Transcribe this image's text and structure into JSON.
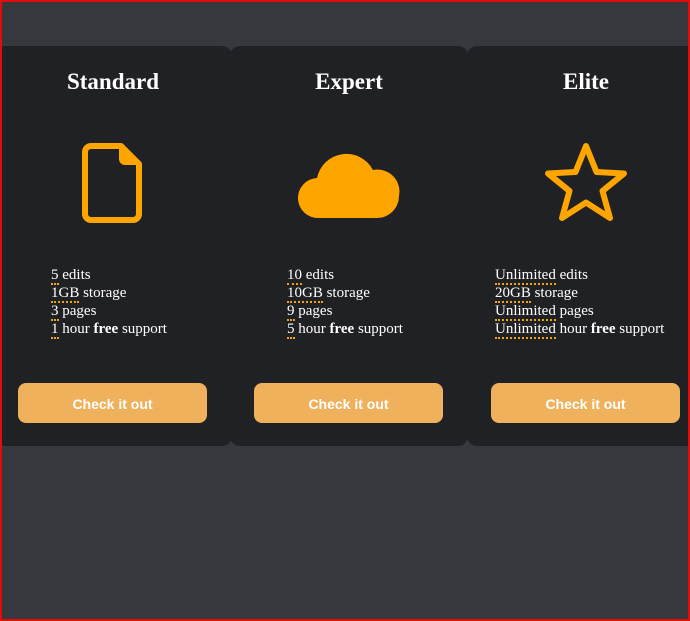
{
  "accent_color": "#ffa500",
  "button_color": "#efb15c",
  "card_background": "#202124",
  "page_background": "#37383d",
  "plans": [
    {
      "name": "Standard",
      "icon": "file-icon",
      "features": [
        {
          "amount": "5",
          "rest": " edits"
        },
        {
          "amount": "1GB",
          "rest": " storage"
        },
        {
          "amount": "3",
          "rest": " pages"
        },
        {
          "amount": "1",
          "rest_before": " hour ",
          "free": "free",
          "rest_after": " support"
        }
      ],
      "button_label": "Check it out"
    },
    {
      "name": "Expert",
      "icon": "cloud-icon",
      "features": [
        {
          "amount": "10",
          "rest": " edits"
        },
        {
          "amount": "10GB",
          "rest": " storage"
        },
        {
          "amount": "9",
          "rest": " pages"
        },
        {
          "amount": "5",
          "rest_before": " hour ",
          "free": "free",
          "rest_after": " support"
        }
      ],
      "button_label": "Check it out"
    },
    {
      "name": "Elite",
      "icon": "star-icon",
      "features": [
        {
          "amount": "Unlimited",
          "rest": " edits"
        },
        {
          "amount": "20GB",
          "rest": " storage"
        },
        {
          "amount": "Unlimited",
          "rest": " pages"
        },
        {
          "amount": "Unlimited",
          "rest_before": " hour ",
          "free": "free",
          "rest_after": " support"
        }
      ],
      "button_label": "Check it out"
    }
  ]
}
